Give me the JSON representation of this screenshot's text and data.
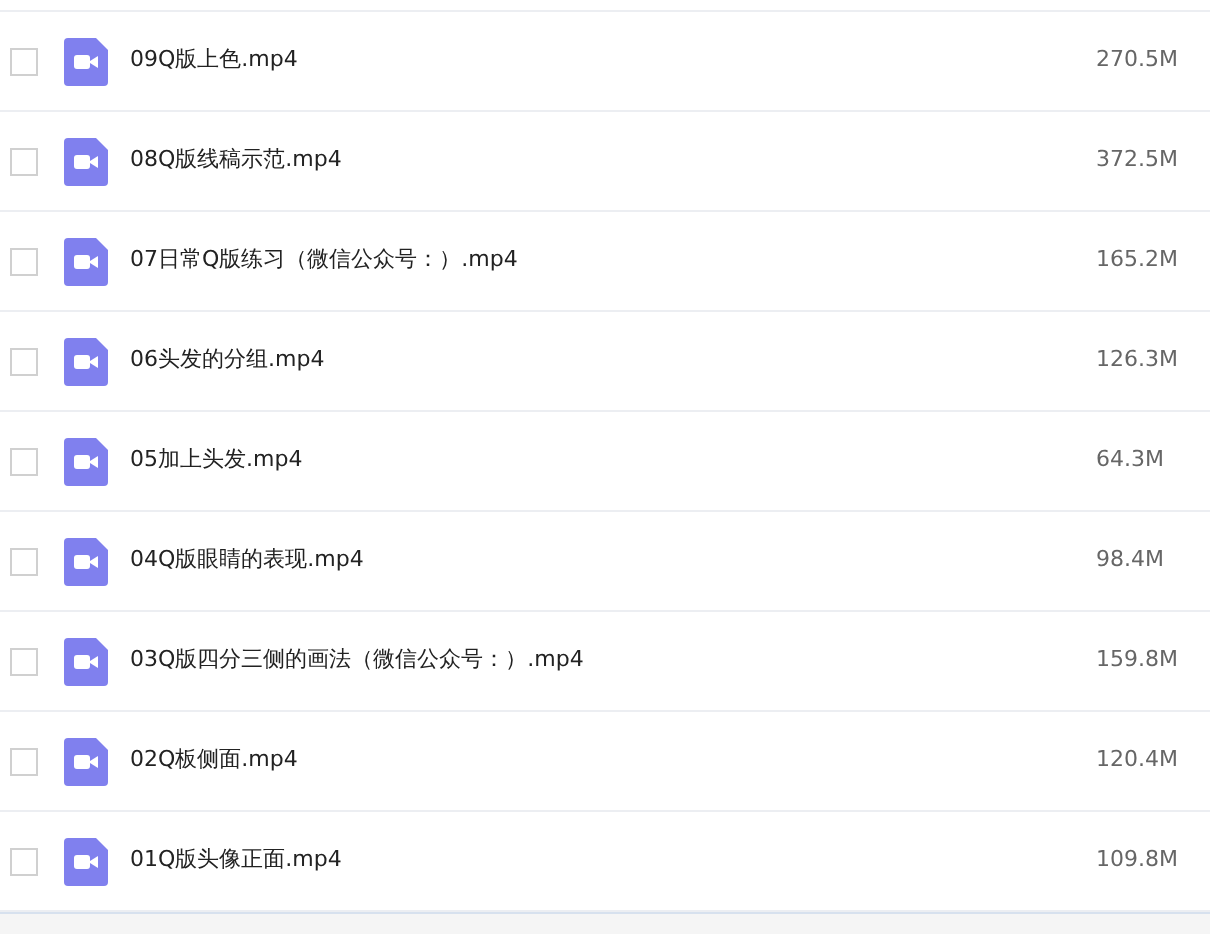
{
  "files": [
    {
      "name": "09Q版上色.mp4",
      "size": "270.5M",
      "checked": false
    },
    {
      "name": "08Q版线稿示范.mp4",
      "size": "372.5M",
      "checked": false
    },
    {
      "name": "07日常Q版练习（微信公众号：）.mp4",
      "size": "165.2M",
      "checked": false
    },
    {
      "name": "06头发的分组.mp4",
      "size": "126.3M",
      "checked": false
    },
    {
      "name": "05加上头发.mp4",
      "size": "64.3M",
      "checked": false
    },
    {
      "name": "04Q版眼睛的表现.mp4",
      "size": "98.4M",
      "checked": false
    },
    {
      "name": "03Q版四分三侧的画法（微信公众号：）.mp4",
      "size": "159.8M",
      "checked": false
    },
    {
      "name": "02Q板侧面.mp4",
      "size": "120.4M",
      "checked": false
    },
    {
      "name": "01Q版头像正面.mp4",
      "size": "109.8M",
      "checked": false
    }
  ]
}
